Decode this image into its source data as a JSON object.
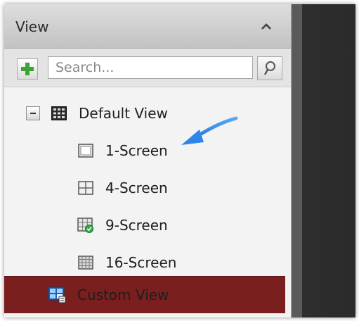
{
  "panel": {
    "title": "View"
  },
  "toolbar": {
    "search_placeholder": "Search..."
  },
  "tree": {
    "root": {
      "label": "Default View",
      "icon": "grid-view-icon",
      "expanded": true
    },
    "children": [
      {
        "label": "1-Screen",
        "icon": "one-screen-icon"
      },
      {
        "label": "4-Screen",
        "icon": "four-screen-icon"
      },
      {
        "label": "9-Screen",
        "icon": "nine-screen-icon"
      },
      {
        "label": "16-Screen",
        "icon": "sixteen-screen-icon"
      }
    ],
    "custom": {
      "label": "Custom View",
      "icon": "custom-view-icon",
      "selected": true
    }
  },
  "colors": {
    "selected_row": "#7a1f1e",
    "add_icon": "#3aa535",
    "arrow": "#2f86e8"
  }
}
